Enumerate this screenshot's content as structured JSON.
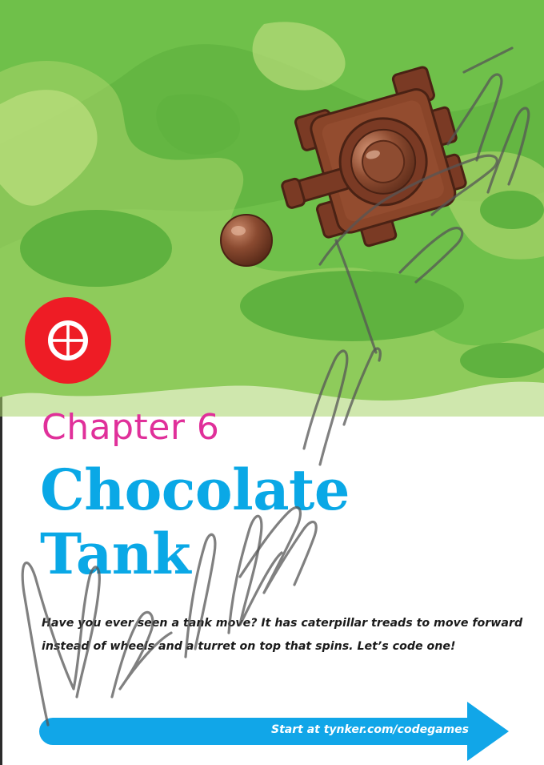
{
  "chapter": {
    "label": "Chapter 6",
    "title_lines": [
      "Chocolate",
      "Tank"
    ]
  },
  "intro": {
    "lines": [
      "Have you ever seen a tank move? It has caterpillar treads to move forward",
      "instead of wheels and a turret on top that spins. Let’s code one!"
    ]
  },
  "cta": {
    "label": "Start at tynker.com/codegames"
  },
  "icons": {
    "target": "crosshair-target-icon",
    "tank": "chocolate-tank-sprite",
    "ball": "chocolate-cannonball",
    "arrow": "arrow-right-icon"
  },
  "colors": {
    "grass": "#6fc04a",
    "grass_light": "#a8d36a",
    "chapter_pink": "#e0309a",
    "title_blue": "#0aa8e6",
    "cta_blue": "#11a6e8",
    "target_red": "#ee1c25",
    "chocolate": "#7a3a24"
  }
}
